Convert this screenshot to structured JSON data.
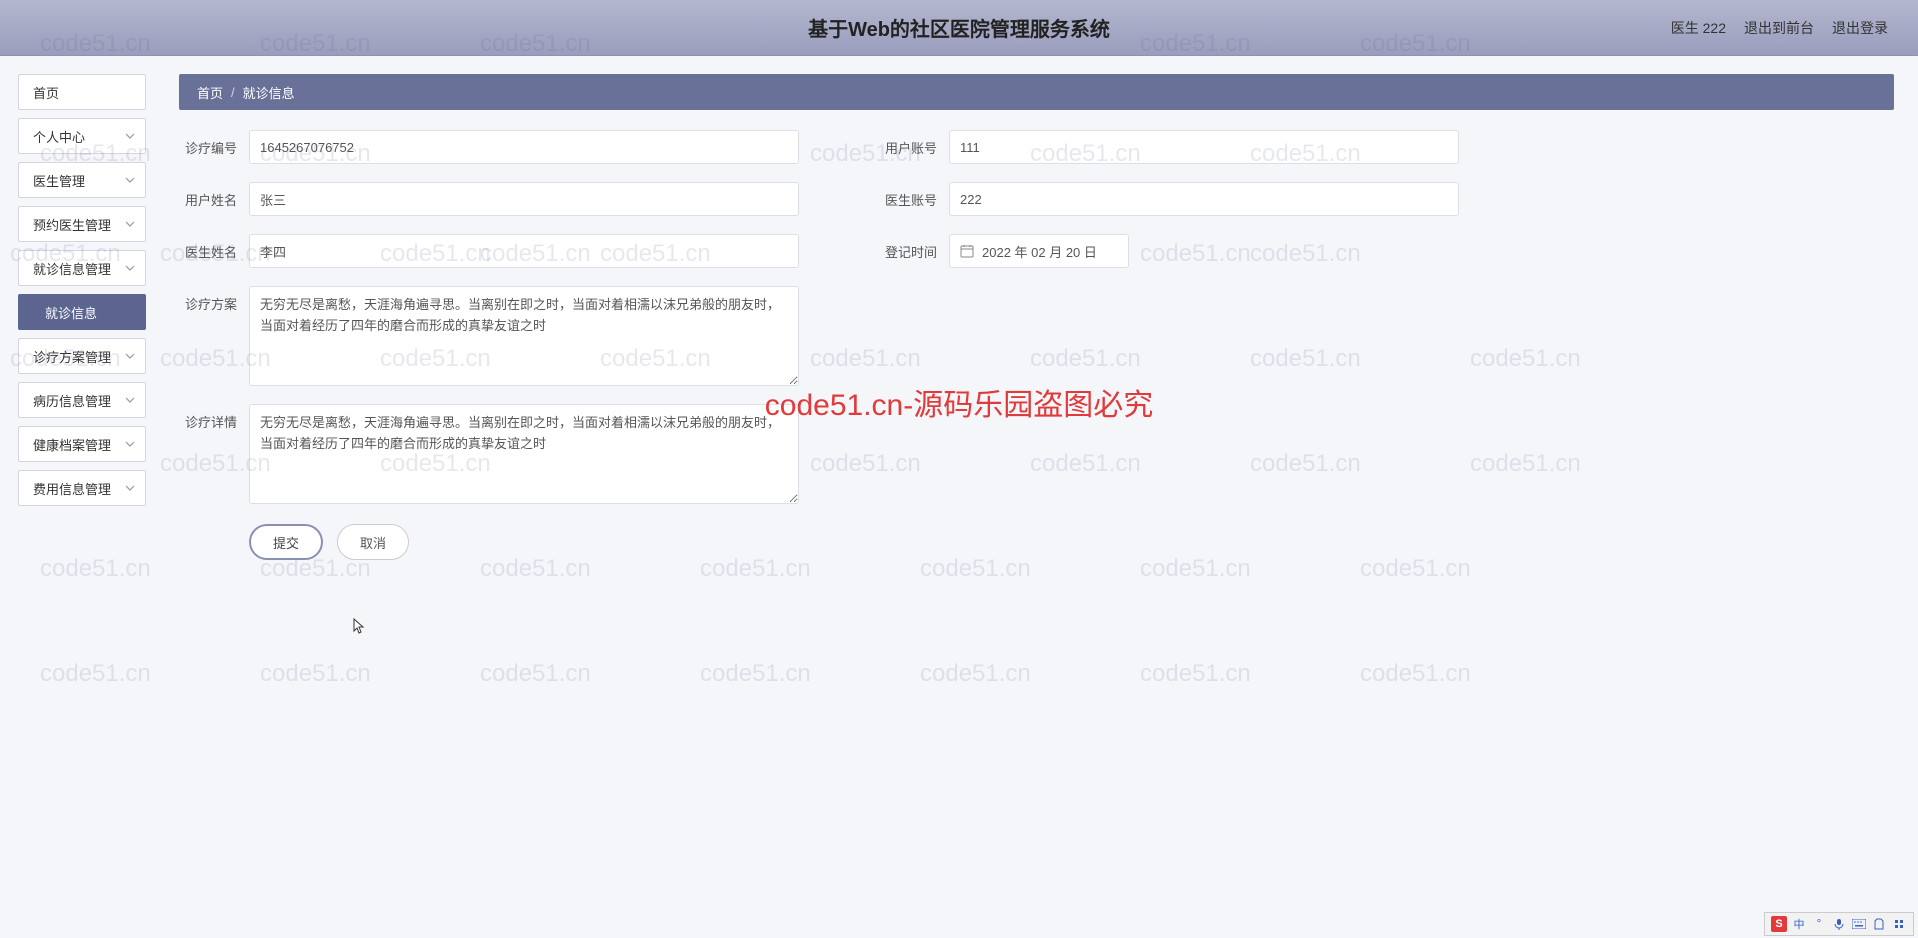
{
  "header": {
    "title": "基于Web的社区医院管理服务系统",
    "user": "医生 222",
    "exit_front": "退出到前台",
    "logout": "退出登录"
  },
  "sidebar": {
    "items": [
      {
        "label": "首页",
        "expandable": false
      },
      {
        "label": "个人中心",
        "expandable": true
      },
      {
        "label": "医生管理",
        "expandable": true
      },
      {
        "label": "预约医生管理",
        "expandable": true
      },
      {
        "label": "就诊信息管理",
        "expandable": true
      },
      {
        "label": "就诊信息",
        "expandable": false,
        "active": true
      },
      {
        "label": "诊疗方案管理",
        "expandable": true
      },
      {
        "label": "病历信息管理",
        "expandable": true
      },
      {
        "label": "健康档案管理",
        "expandable": true
      },
      {
        "label": "费用信息管理",
        "expandable": true
      }
    ]
  },
  "breadcrumb": {
    "home": "首页",
    "sep": "/",
    "current": "就诊信息"
  },
  "form": {
    "labels": {
      "diag_no": "诊疗编号",
      "user_account": "用户账号",
      "user_name": "用户姓名",
      "doctor_account": "医生账号",
      "doctor_name": "医生姓名",
      "reg_time": "登记时间",
      "treat_plan": "诊疗方案",
      "treat_detail": "诊疗详情"
    },
    "values": {
      "diag_no": "1645267076752",
      "user_account": "111",
      "user_name": "张三",
      "doctor_account": "222",
      "doctor_name": "李四",
      "reg_time": "2022 年 02 月 20 日",
      "treat_plan": "无穷无尽是离愁，天涯海角遍寻思。当离别在即之时，当面对着相濡以沫兄弟般的朋友时，当面对着经历了四年的磨合而形成的真挚友谊之时",
      "treat_detail": "无穷无尽是离愁，天涯海角遍寻思。当离别在即之时，当面对着相濡以沫兄弟般的朋友时，当面对着经历了四年的磨合而形成的真挚友谊之时"
    },
    "buttons": {
      "submit": "提交",
      "cancel": "取消"
    }
  },
  "watermark": {
    "text": "code51.cn",
    "red": "code51.cn-源码乐园盗图必究"
  },
  "ime": {
    "logo": "S",
    "lang": "中"
  }
}
